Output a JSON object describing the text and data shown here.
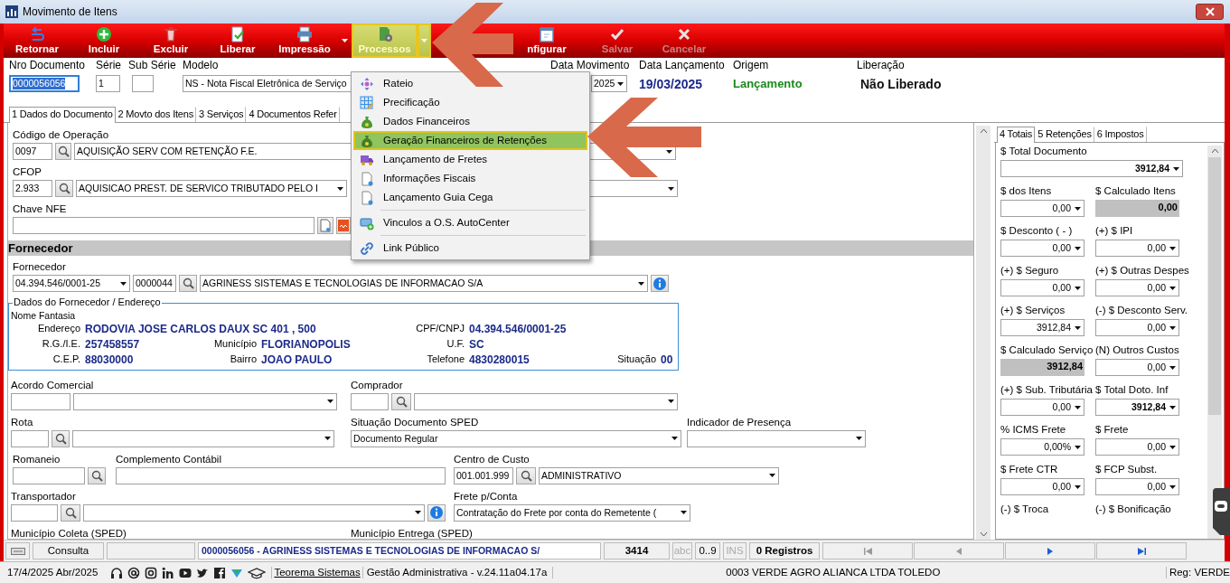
{
  "window": {
    "title": "Movimento de Itens"
  },
  "toolbar": [
    {
      "label": "Retornar",
      "disabled": false,
      "selected": false,
      "dropdown": false
    },
    {
      "label": "Incluir",
      "disabled": false,
      "selected": false,
      "dropdown": false
    },
    {
      "label": "Excluir",
      "disabled": false,
      "selected": false,
      "dropdown": false
    },
    {
      "label": "Liberar",
      "disabled": false,
      "selected": false,
      "dropdown": false
    },
    {
      "label": "Impressão",
      "disabled": false,
      "selected": false,
      "dropdown": true
    },
    {
      "label": "Processos",
      "disabled": false,
      "selected": true,
      "dropdown": true
    },
    {
      "label": "nfigurar",
      "disabled": false,
      "selected": false,
      "dropdown": false
    },
    {
      "label": "Salvar",
      "disabled": true,
      "selected": false,
      "dropdown": false
    },
    {
      "label": "Cancelar",
      "disabled": true,
      "selected": false,
      "dropdown": false
    }
  ],
  "header": [
    {
      "label": "Nro Documento",
      "kind": "input",
      "value": "0000056056",
      "text_selected": true
    },
    {
      "label": "Série",
      "kind": "input",
      "value": "1",
      "text_selected": false
    },
    {
      "label": "Sub Série",
      "kind": "input"
    },
    {
      "label": "Modelo",
      "kind": "combo",
      "value": "NS - Nota Fiscal Eletrônica de Serviço"
    },
    {
      "label": "Data Movimento",
      "kind": "combo",
      "value": "2025"
    },
    {
      "label": "Data Lançamento",
      "kind": "date",
      "value": "19/03/2025"
    },
    {
      "label": "Origem",
      "kind": "origin",
      "value": "Lançamento"
    },
    {
      "label": "Liberação",
      "kind": "status",
      "value": "Não Liberado"
    }
  ],
  "tabs": [
    {
      "label": "1 Dados do Documento",
      "selected": true
    },
    {
      "label": "2 Movto dos Itens",
      "selected": false
    },
    {
      "label": "3 Serviços",
      "selected": false
    },
    {
      "label": "4 Documentos Refer",
      "selected": false
    }
  ],
  "form": [
    {
      "kind": "row",
      "groups": [
        {
          "label": "Código de Operação",
          "controls": [
            {
              "kind": "input",
              "value": "0097"
            },
            {
              "kind": "lookup"
            },
            {
              "kind": "combo",
              "value": "AQUISIÇÃO SERV COM RETENÇÃO F.E."
            }
          ]
        }
      ]
    },
    {
      "kind": "row",
      "groups": [
        {
          "label": "CFOP",
          "controls": [
            {
              "kind": "input",
              "value": "2.933"
            },
            {
              "kind": "lookup"
            },
            {
              "kind": "combo",
              "value": "AQUISICAO PREST. DE SERVICO TRIBUTADO PELO I"
            }
          ]
        },
        {
          "controls": [
            {
              "kind": "combo"
            }
          ]
        }
      ]
    },
    {
      "kind": "row",
      "groups": [
        {
          "label": "Chave NFE",
          "controls": [
            {
              "kind": "input"
            },
            {
              "kind": "document"
            },
            {
              "kind": "pdf"
            }
          ]
        }
      ]
    },
    {
      "kind": "section",
      "title": "Fornecedor"
    },
    {
      "kind": "row",
      "groups": [
        {
          "label": "Fornecedor",
          "controls": [
            {
              "kind": "combo",
              "value": "04.394.546/0001-25"
            },
            {
              "kind": "input",
              "value": "0000044"
            },
            {
              "kind": "lookup"
            },
            {
              "kind": "combo",
              "value": "AGRINESS SISTEMAS E TECNOLOGIAS DE INFORMACAO S/A"
            },
            {
              "kind": "info"
            }
          ]
        }
      ]
    },
    {
      "kind": "address",
      "title": "Dados do Fornecedor / Endereço",
      "subtitle": "Nome Fantasia",
      "rows": [
        [
          {
            "label": "Endereço",
            "value": "RODOVIA JOSE CARLOS DAUX SC 401 , 500"
          },
          null,
          {
            "label": "CPF/CNPJ",
            "value": "04.394.546/0001-25"
          }
        ],
        [
          {
            "label": "R.G./I.E.",
            "value": "257458557"
          },
          {
            "label": "Município",
            "value": "FLORIANOPOLIS"
          },
          {
            "label": "U.F.",
            "value": "SC"
          }
        ],
        [
          {
            "label": "C.E.P.",
            "value": "88030000"
          },
          {
            "label": "Bairro",
            "value": "JOAO PAULO"
          },
          {
            "label": "Telefone",
            "value": "4830280015"
          },
          {
            "label": "Situação",
            "value": "00"
          }
        ]
      ]
    },
    {
      "kind": "row",
      "groups": [
        {
          "label": "Acordo Comercial",
          "controls": [
            {
              "kind": "input"
            },
            {
              "kind": "combo"
            }
          ]
        },
        {
          "label": "Comprador",
          "controls": [
            {
              "kind": "input"
            },
            {
              "kind": "lookup"
            },
            {
              "kind": "combo"
            }
          ]
        }
      ]
    },
    {
      "kind": "row",
      "groups": [
        {
          "label": "Rota",
          "controls": [
            {
              "kind": "input"
            },
            {
              "kind": "lookup"
            },
            {
              "kind": "combo"
            }
          ]
        },
        {
          "label": "Situação Documento SPED",
          "controls": [
            {
              "kind": "combo",
              "value": "Documento Regular"
            }
          ]
        },
        {
          "label": "Indicador de Presença",
          "controls": [
            {
              "kind": "combo"
            }
          ]
        }
      ]
    },
    {
      "kind": "row",
      "groups": [
        {
          "label": "Romaneio",
          "controls": [
            {
              "kind": "input"
            },
            {
              "kind": "lookup"
            }
          ]
        },
        {
          "label": "Complemento Contábil",
          "controls": [
            {
              "kind": "input"
            }
          ]
        },
        {
          "label": "Centro de Custo",
          "controls": [
            {
              "kind": "input",
              "value": "001.001.999"
            },
            {
              "kind": "lookup"
            },
            {
              "kind": "combo",
              "value": "ADMINISTRATIVO"
            }
          ]
        }
      ]
    },
    {
      "kind": "row",
      "groups": [
        {
          "label": "Transportador",
          "controls": [
            {
              "kind": "input"
            },
            {
              "kind": "lookup"
            },
            {
              "kind": "combo"
            },
            {
              "kind": "info"
            }
          ]
        },
        {
          "label": "Frete p/Conta",
          "controls": [
            {
              "kind": "combo",
              "value": "Contratação do Frete por conta do Remetente ("
            }
          ]
        }
      ]
    },
    {
      "kind": "row",
      "groups": [
        {
          "label": "Município Coleta (SPED)"
        },
        {
          "label": "Município Entrega (SPED)"
        }
      ]
    }
  ],
  "menu": [
    {
      "label": "Rateio",
      "selected": false,
      "separator_before": false
    },
    {
      "label": "Precificação",
      "selected": false,
      "separator_before": false
    },
    {
      "label": "Dados Financeiros",
      "selected": false,
      "separator_before": false
    },
    {
      "label": "Geração Financeiros de Retenções",
      "selected": true,
      "separator_before": false
    },
    {
      "label": "Lançamento de Fretes",
      "selected": false,
      "separator_before": false
    },
    {
      "label": "Informações Fiscais",
      "selected": false,
      "separator_before": false
    },
    {
      "label": "Lançamento Guia Cega",
      "selected": false,
      "separator_before": false
    },
    {
      "label": "Vinculos a O.S. AutoCenter",
      "selected": false,
      "separator_before": true
    },
    {
      "label": "Link Público",
      "selected": false,
      "separator_before": true
    }
  ],
  "totals": {
    "tabs": [
      {
        "label": "4 Totais",
        "selected": true
      },
      {
        "label": "5 Retenções",
        "selected": false
      },
      {
        "label": "6 Impostos",
        "selected": false
      }
    ],
    "rows": [
      [
        {
          "label": "$ Total Documento",
          "kind": "combo",
          "value": "3912,84",
          "bold": true
        }
      ],
      [
        {
          "label": "$ dos Itens",
          "kind": "combo",
          "value": "0,00",
          "bold": false
        },
        {
          "label": "$ Calculado Itens",
          "kind": "readonly",
          "value": "0,00",
          "bold": true
        }
      ],
      [
        {
          "label": "$ Desconto ( - )",
          "kind": "combo",
          "value": "0,00",
          "bold": false
        },
        {
          "label": "(+) $ IPI",
          "kind": "combo",
          "value": "0,00",
          "bold": false
        }
      ],
      [
        {
          "label": "(+) $ Seguro",
          "kind": "combo",
          "value": "0,00",
          "bold": false
        },
        {
          "label": "(+) $ Outras Despes",
          "kind": "combo",
          "value": "0,00",
          "bold": false
        }
      ],
      [
        {
          "label": "(+) $ Serviços",
          "kind": "combo",
          "value": "3912,84",
          "bold": false
        },
        {
          "label": "(-) $ Desconto Serv.",
          "kind": "combo",
          "value": "0,00",
          "bold": false
        }
      ],
      [
        {
          "label": "$ Calculado Serviço",
          "kind": "readonly",
          "value": "3912,84",
          "bold": true
        },
        {
          "label": "(N) Outros Custos",
          "kind": "combo",
          "value": "0,00",
          "bold": false
        }
      ],
      [
        {
          "label": "(+) $ Sub. Tributária",
          "kind": "combo",
          "value": "0,00",
          "bold": false
        },
        {
          "label": "$ Total Doto. Inf",
          "kind": "combo",
          "value": "3912,84",
          "bold": true
        }
      ],
      [
        {
          "label": "% ICMS Frete",
          "kind": "combo",
          "value": "0,00%",
          "bold": false
        },
        {
          "label": "$ Frete",
          "kind": "combo",
          "value": "0,00",
          "bold": false
        }
      ],
      [
        {
          "label": "$ Frete CTR",
          "kind": "combo",
          "value": "0,00",
          "bold": false
        },
        {
          "label": "$ FCP Subst.",
          "kind": "combo",
          "value": "0,00",
          "bold": false
        }
      ],
      [
        {
          "label": "(-) $ Troca",
          "kind": "label"
        },
        {
          "label": "(-) $ Bonificação",
          "kind": "label"
        }
      ]
    ]
  },
  "status_bar": {
    "mode": "Consulta",
    "record": "0000056056 - AGRINESS SISTEMAS E TECNOLOGIAS DE INFORMACAO S/",
    "code": "3414",
    "indicators": [
      {
        "label": "abc",
        "on": false
      },
      {
        "label": "0..9",
        "on": true
      },
      {
        "label": "INS",
        "on": false
      }
    ],
    "count": "0 Registros",
    "navigation": [
      {
        "enabled": false
      },
      {
        "enabled": false
      },
      {
        "enabled": true
      },
      {
        "enabled": true
      }
    ]
  },
  "footer": {
    "date": "17/4/2025 Abr/2025",
    "link": "Teorema Sistemas",
    "version": "Gestão Administrativa - v.24.11a04.17a",
    "company": "0003 VERDE AGRO ALIANCA LTDA TOLEDO",
    "registration": "Reg: VERDE"
  }
}
